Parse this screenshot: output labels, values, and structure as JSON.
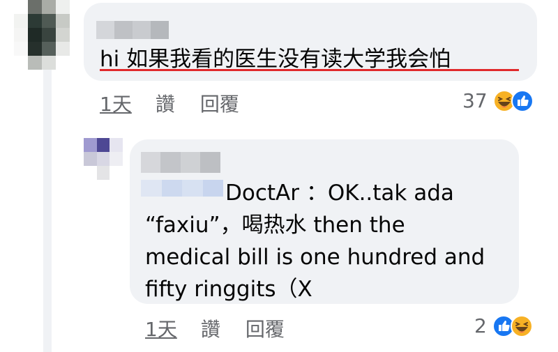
{
  "comment": {
    "text": "hi 如果我看的医生没有读大学我会怕",
    "time": "1天",
    "like_label": "讚",
    "reply_label": "回覆",
    "reaction_count": "37",
    "reactions": [
      "haha-icon",
      "like-icon"
    ]
  },
  "reply": {
    "line1": "DoctAr ：OK..tak ada",
    "line2": "“faxiu”，喝热水 then the",
    "line3": "medical bill is one hundred and",
    "line4": "fifty ringgits（X",
    "time": "1天",
    "like_label": "讚",
    "reply_label": "回覆",
    "reaction_count": "2",
    "reactions": [
      "like-icon",
      "haha-icon"
    ]
  },
  "colors": {
    "bubble": "#f0f2f5",
    "underline": "#e0292b",
    "meta_text": "#65676b",
    "like_blue": "#1877f2",
    "haha_yellow": "#f7b125"
  }
}
